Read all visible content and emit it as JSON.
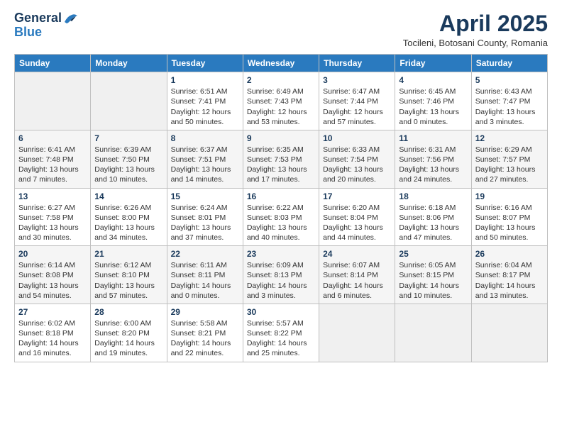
{
  "header": {
    "logo_general": "General",
    "logo_blue": "Blue",
    "title": "April 2025",
    "subtitle": "Tocileni, Botosani County, Romania"
  },
  "days_of_week": [
    "Sunday",
    "Monday",
    "Tuesday",
    "Wednesday",
    "Thursday",
    "Friday",
    "Saturday"
  ],
  "weeks": [
    [
      {
        "day": "",
        "info": ""
      },
      {
        "day": "",
        "info": ""
      },
      {
        "day": "1",
        "info": "Sunrise: 6:51 AM\nSunset: 7:41 PM\nDaylight: 12 hours\nand 50 minutes."
      },
      {
        "day": "2",
        "info": "Sunrise: 6:49 AM\nSunset: 7:43 PM\nDaylight: 12 hours\nand 53 minutes."
      },
      {
        "day": "3",
        "info": "Sunrise: 6:47 AM\nSunset: 7:44 PM\nDaylight: 12 hours\nand 57 minutes."
      },
      {
        "day": "4",
        "info": "Sunrise: 6:45 AM\nSunset: 7:46 PM\nDaylight: 13 hours\nand 0 minutes."
      },
      {
        "day": "5",
        "info": "Sunrise: 6:43 AM\nSunset: 7:47 PM\nDaylight: 13 hours\nand 3 minutes."
      }
    ],
    [
      {
        "day": "6",
        "info": "Sunrise: 6:41 AM\nSunset: 7:48 PM\nDaylight: 13 hours\nand 7 minutes."
      },
      {
        "day": "7",
        "info": "Sunrise: 6:39 AM\nSunset: 7:50 PM\nDaylight: 13 hours\nand 10 minutes."
      },
      {
        "day": "8",
        "info": "Sunrise: 6:37 AM\nSunset: 7:51 PM\nDaylight: 13 hours\nand 14 minutes."
      },
      {
        "day": "9",
        "info": "Sunrise: 6:35 AM\nSunset: 7:53 PM\nDaylight: 13 hours\nand 17 minutes."
      },
      {
        "day": "10",
        "info": "Sunrise: 6:33 AM\nSunset: 7:54 PM\nDaylight: 13 hours\nand 20 minutes."
      },
      {
        "day": "11",
        "info": "Sunrise: 6:31 AM\nSunset: 7:56 PM\nDaylight: 13 hours\nand 24 minutes."
      },
      {
        "day": "12",
        "info": "Sunrise: 6:29 AM\nSunset: 7:57 PM\nDaylight: 13 hours\nand 27 minutes."
      }
    ],
    [
      {
        "day": "13",
        "info": "Sunrise: 6:27 AM\nSunset: 7:58 PM\nDaylight: 13 hours\nand 30 minutes."
      },
      {
        "day": "14",
        "info": "Sunrise: 6:26 AM\nSunset: 8:00 PM\nDaylight: 13 hours\nand 34 minutes."
      },
      {
        "day": "15",
        "info": "Sunrise: 6:24 AM\nSunset: 8:01 PM\nDaylight: 13 hours\nand 37 minutes."
      },
      {
        "day": "16",
        "info": "Sunrise: 6:22 AM\nSunset: 8:03 PM\nDaylight: 13 hours\nand 40 minutes."
      },
      {
        "day": "17",
        "info": "Sunrise: 6:20 AM\nSunset: 8:04 PM\nDaylight: 13 hours\nand 44 minutes."
      },
      {
        "day": "18",
        "info": "Sunrise: 6:18 AM\nSunset: 8:06 PM\nDaylight: 13 hours\nand 47 minutes."
      },
      {
        "day": "19",
        "info": "Sunrise: 6:16 AM\nSunset: 8:07 PM\nDaylight: 13 hours\nand 50 minutes."
      }
    ],
    [
      {
        "day": "20",
        "info": "Sunrise: 6:14 AM\nSunset: 8:08 PM\nDaylight: 13 hours\nand 54 minutes."
      },
      {
        "day": "21",
        "info": "Sunrise: 6:12 AM\nSunset: 8:10 PM\nDaylight: 13 hours\nand 57 minutes."
      },
      {
        "day": "22",
        "info": "Sunrise: 6:11 AM\nSunset: 8:11 PM\nDaylight: 14 hours\nand 0 minutes."
      },
      {
        "day": "23",
        "info": "Sunrise: 6:09 AM\nSunset: 8:13 PM\nDaylight: 14 hours\nand 3 minutes."
      },
      {
        "day": "24",
        "info": "Sunrise: 6:07 AM\nSunset: 8:14 PM\nDaylight: 14 hours\nand 6 minutes."
      },
      {
        "day": "25",
        "info": "Sunrise: 6:05 AM\nSunset: 8:15 PM\nDaylight: 14 hours\nand 10 minutes."
      },
      {
        "day": "26",
        "info": "Sunrise: 6:04 AM\nSunset: 8:17 PM\nDaylight: 14 hours\nand 13 minutes."
      }
    ],
    [
      {
        "day": "27",
        "info": "Sunrise: 6:02 AM\nSunset: 8:18 PM\nDaylight: 14 hours\nand 16 minutes."
      },
      {
        "day": "28",
        "info": "Sunrise: 6:00 AM\nSunset: 8:20 PM\nDaylight: 14 hours\nand 19 minutes."
      },
      {
        "day": "29",
        "info": "Sunrise: 5:58 AM\nSunset: 8:21 PM\nDaylight: 14 hours\nand 22 minutes."
      },
      {
        "day": "30",
        "info": "Sunrise: 5:57 AM\nSunset: 8:22 PM\nDaylight: 14 hours\nand 25 minutes."
      },
      {
        "day": "",
        "info": ""
      },
      {
        "day": "",
        "info": ""
      },
      {
        "day": "",
        "info": ""
      }
    ]
  ]
}
